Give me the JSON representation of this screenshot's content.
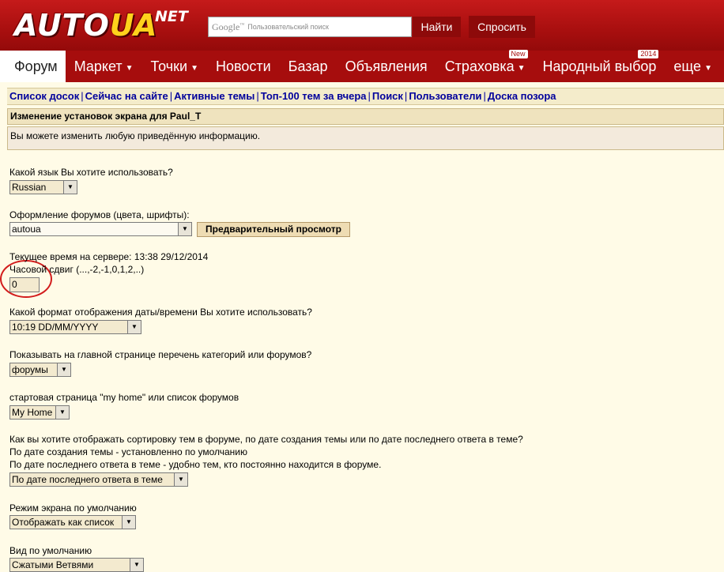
{
  "header": {
    "logo_main": "AUTO",
    "logo_ua": "UA",
    "logo_net": "NET",
    "search_logo": "Google",
    "search_placeholder": "Пользовательский поиск",
    "find_button": "Найти",
    "ask_button": "Спросить"
  },
  "nav": {
    "items": [
      {
        "label": "Форум",
        "active": true
      },
      {
        "label": "Маркет",
        "dropdown": true
      },
      {
        "label": "Точки",
        "dropdown": true
      },
      {
        "label": "Новости"
      },
      {
        "label": "Базар"
      },
      {
        "label": "Объявления"
      },
      {
        "label": "Страховка",
        "dropdown": true,
        "badge": "New"
      },
      {
        "label": "Народный выбор",
        "badge": "2014"
      },
      {
        "label": "еще",
        "dropdown": true
      }
    ]
  },
  "linkbar": [
    "Список досок",
    "Сейчас на сайте",
    "Активные темы",
    "Топ-100 тем за вчера",
    "Поиск",
    "Пользователи",
    "Доска позора"
  ],
  "title": "Изменение установок экрана для Paul_T",
  "info": "Вы можете изменить любую приведённую информацию.",
  "fields": {
    "language_label": "Какой язык Вы хотите использовать?",
    "language_value": "Russian",
    "theme_label": "Оформление форумов (цвета, шрифты):",
    "theme_value": "autoua",
    "preview_button": "Предварительный просмотр",
    "server_time": "Текущее время на сервере: 13:38 29/12/2014",
    "tz_label": "Часовой сдвиг (...,-2,-1,0,1,2,..)",
    "tz_value": "0",
    "datefmt_label": "Какой формат отображения даты/времени Вы хотите использовать?",
    "datefmt_value": "10:19 DD/MM/YYYY",
    "cats_label": "Показывать на главной странице перечень категорий или форумов?",
    "cats_value": "форумы",
    "home_label": "стартовая страница \"my home\" или список форумов",
    "home_value": "My Home",
    "sort_label_1": "Как вы хотите отображать сортировку тем в форуме, по дате создания темы или по дате последнего ответа в теме?",
    "sort_label_2": "По дате создания темы - установленно по умолчанию",
    "sort_label_3": "По дате последнего ответа в теме - удобно тем, кто постоянно находится в форуме.",
    "sort_value": "По дате последнего ответа в теме",
    "mode_label": "Режим экрана по умолчанию",
    "mode_value": "Отображать как список",
    "view_label": "Вид по умолчанию",
    "view_value": "Сжатыми Ветвями"
  }
}
